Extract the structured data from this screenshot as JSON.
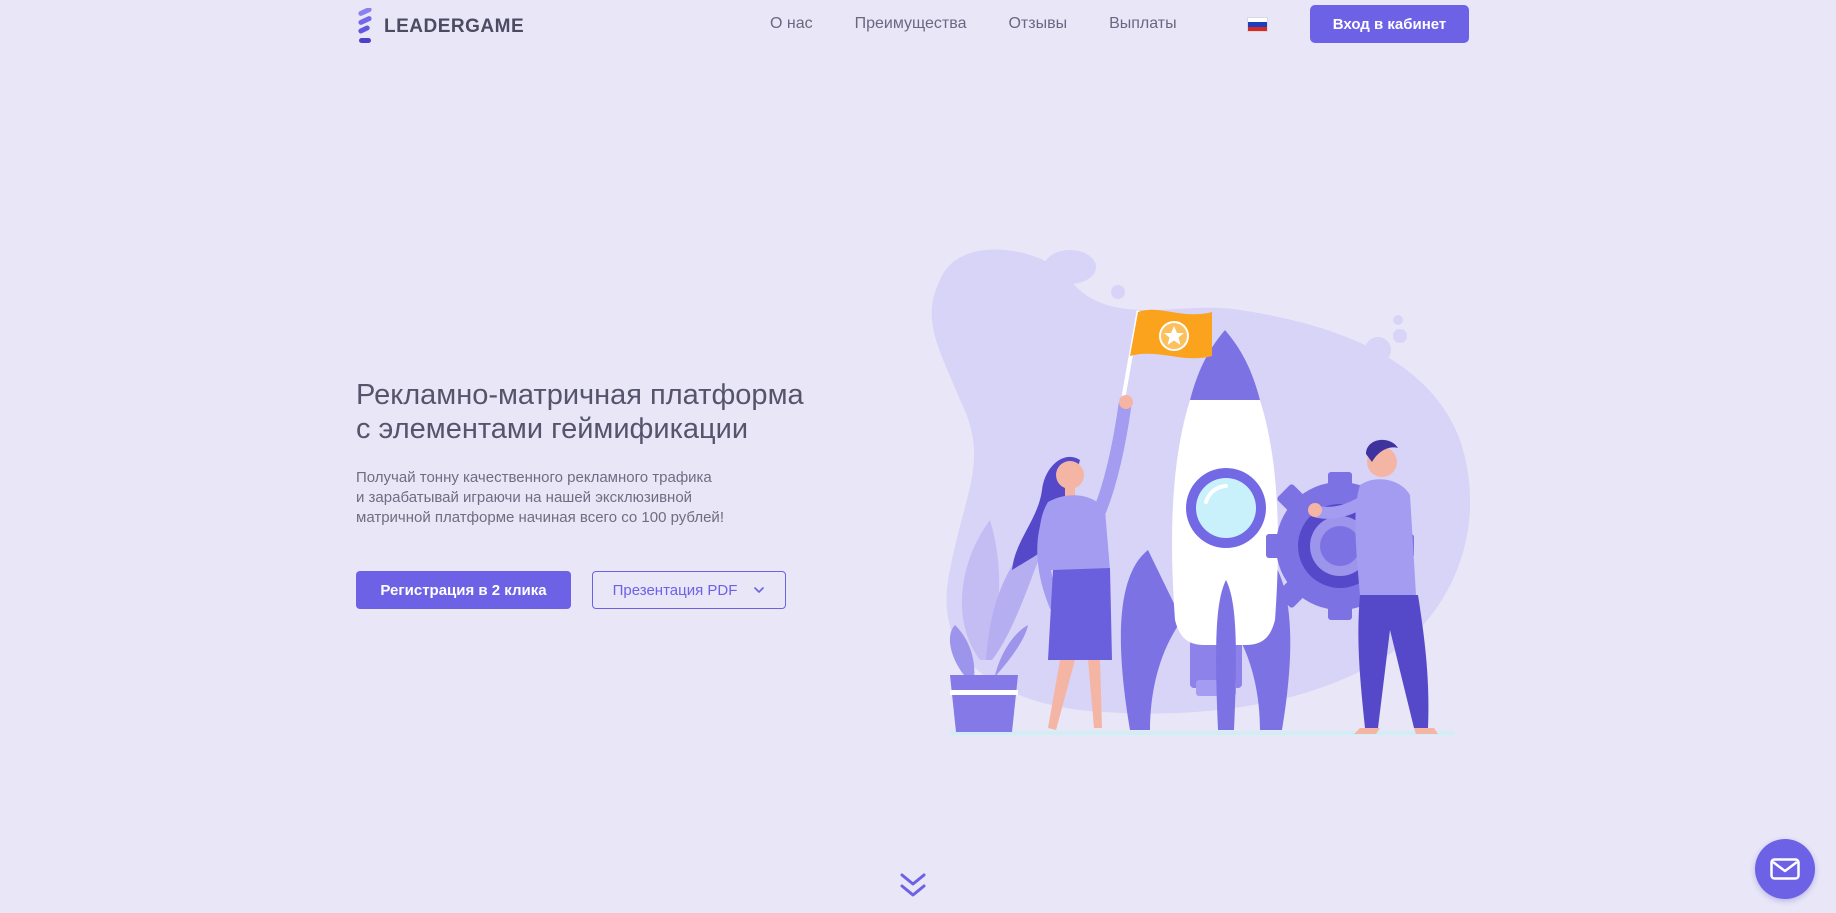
{
  "header": {
    "logo_text": "LEADERGAME",
    "nav": [
      "О нас",
      "Преимущества",
      "Отзывы",
      "Выплаты"
    ],
    "language_icon": "russia-flag-icon",
    "cabinet_button": "Вход в кабинет"
  },
  "hero": {
    "title_lines": [
      "Рекламно-матричная платформа",
      "с элементами геймификации"
    ],
    "subtitle_lines": [
      "Получай тонну качественного рекламного трафика",
      "и зарабатывай играючи на нашей эксклюзивной",
      "матричной платформе начиная всего со 100 рублей!"
    ],
    "register_button": "Регистрация в 2 клика",
    "pdf_button": "Презентация PDF",
    "illustration": "rocket-launch-illustration"
  },
  "widgets": {
    "scroll_icon": "double-chevron-down-icon",
    "chat_icon": "envelope-icon"
  },
  "colors": {
    "background": "#e8e6f7",
    "accent": "#6d61e6",
    "text": "#56546b",
    "flag_orange": "#fba31d"
  }
}
